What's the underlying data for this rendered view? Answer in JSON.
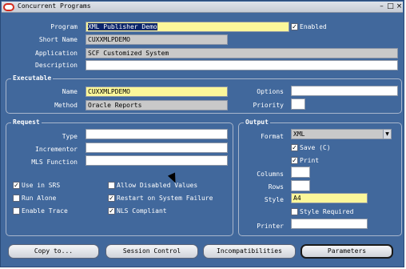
{
  "window": {
    "title": "Concurrent Programs"
  },
  "colors": {
    "background": "#41689c",
    "required": "#fbf79a",
    "readonly": "#c9c9c9",
    "selection": "#0a246a"
  },
  "program": {
    "program_label": "Program",
    "program_value": "XML Publisher Demo",
    "enabled_label": "Enabled",
    "enabled_checked": true,
    "short_name_label": "Short Name",
    "short_name_value": "CUXXMLPDEMO",
    "application_label": "Application",
    "application_value": "SCF Customized System",
    "description_label": "Description",
    "description_value": ""
  },
  "executable": {
    "title": "Executable",
    "name_label": "Name",
    "name_value": "CUXXMLPDEMO",
    "method_label": "Method",
    "method_value": "Oracle Reports",
    "options_label": "Options",
    "options_value": "",
    "priority_label": "Priority",
    "priority_value": ""
  },
  "request": {
    "title": "Request",
    "type_label": "Type",
    "type_value": "",
    "incrementor_label": "Incrementor",
    "incrementor_value": "",
    "mls_label": "MLS Function",
    "mls_value": "",
    "checkboxes": {
      "use_in_srs": {
        "label": "Use in SRS",
        "checked": true
      },
      "run_alone": {
        "label": "Run Alone",
        "checked": false
      },
      "enable_trace": {
        "label": "Enable Trace",
        "checked": false
      },
      "allow_disabled": {
        "label": "Allow Disabled Values",
        "checked": false
      },
      "restart": {
        "label": "Restart on System Failure",
        "checked": true
      },
      "nls": {
        "label": "NLS Compliant",
        "checked": true
      }
    }
  },
  "output": {
    "title": "Output",
    "format_label": "Format",
    "format_value": "XML",
    "save_label": "Save (C)",
    "save_checked": true,
    "print_label": "Print",
    "print_checked": true,
    "columns_label": "Columns",
    "columns_value": "",
    "rows_label": "Rows",
    "rows_value": "",
    "style_label": "Style",
    "style_value": "A4",
    "style_required_label": "Style Required",
    "style_required_checked": false,
    "printer_label": "Printer",
    "printer_value": ""
  },
  "buttons": {
    "copy_to": "Copy to...",
    "session_control": "Session Control",
    "incompatibilities": "Incompatibilities",
    "parameters": "Parameters"
  }
}
